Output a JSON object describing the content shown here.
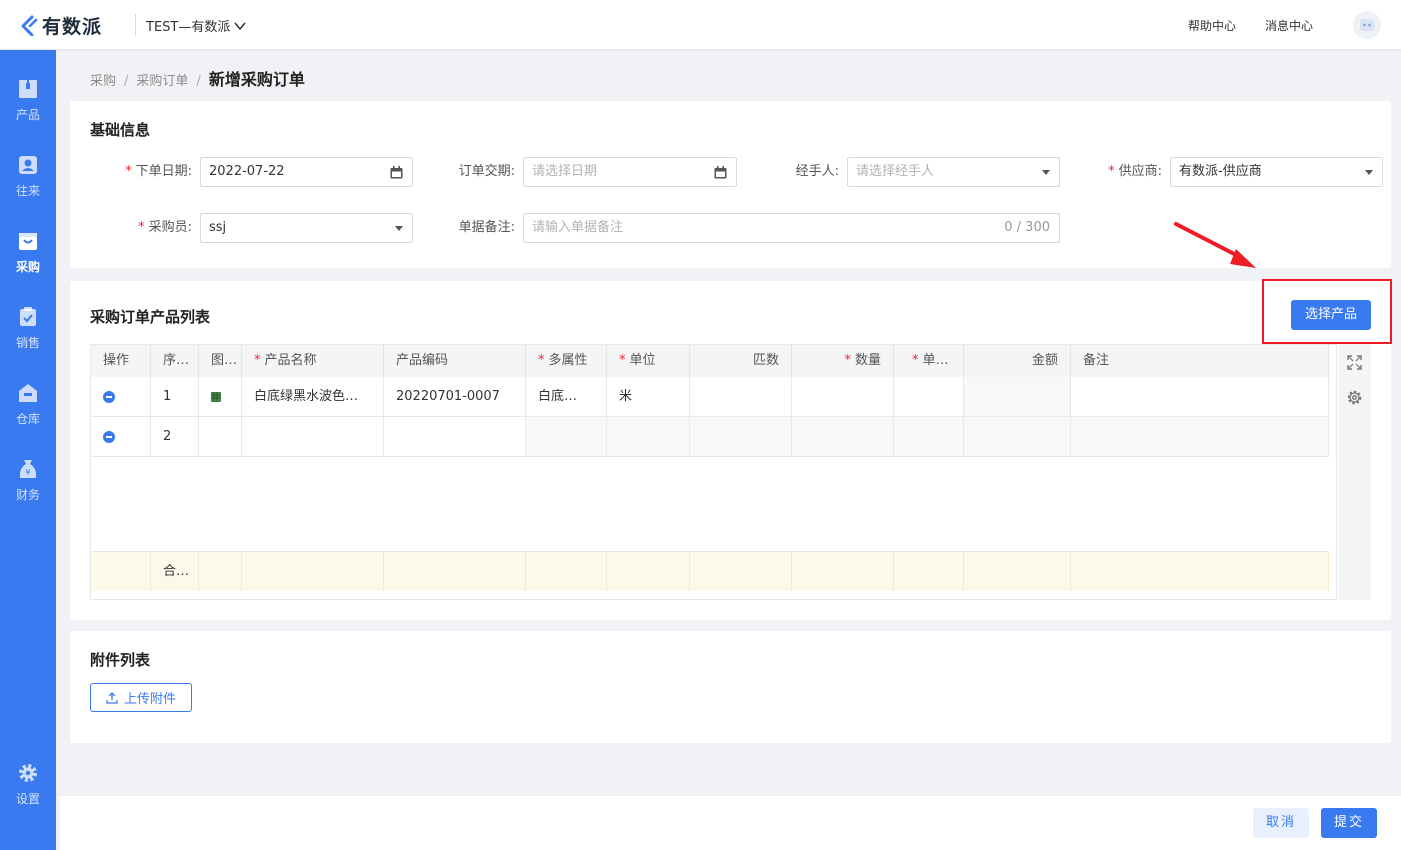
{
  "app": {
    "logo_text": "有数派",
    "company": "TEST—有数派",
    "help": "帮助中心",
    "messages": "消息中心"
  },
  "nav": [
    {
      "label": "产品",
      "icon": "box-icon"
    },
    {
      "label": "往来",
      "icon": "contacts-icon"
    },
    {
      "label": "采购",
      "icon": "bag-icon",
      "active": true
    },
    {
      "label": "销售",
      "icon": "clipboard-check-icon"
    },
    {
      "label": "仓库",
      "icon": "warehouse-icon"
    },
    {
      "label": "财务",
      "icon": "money-bag-icon"
    },
    {
      "label": "设置",
      "icon": "gear-icon"
    }
  ],
  "breadcrumb": [
    "采购",
    "采购订单",
    "新增采购订单"
  ],
  "basic": {
    "title": "基础信息",
    "order_date_label": "下单日期:",
    "order_date_value": "2022-07-22",
    "delivery_label": "订单交期:",
    "delivery_placeholder": "请选择日期",
    "handler_label": "经手人:",
    "handler_placeholder": "请选择经手人",
    "supplier_label": "供应商:",
    "supplier_value": "有数派-供应商",
    "buyer_label": "采购员:",
    "buyer_value": "ssj",
    "remark_label": "单据备注:",
    "remark_placeholder": "请输入单据备注",
    "remark_counter": "0 / 300"
  },
  "products": {
    "title": "采购订单产品列表",
    "select_button": "选择产品",
    "columns": [
      "操作",
      "序…",
      "图…",
      "产品名称",
      "产品编码",
      "多属性",
      "单位",
      "匹数",
      "数量",
      "单…",
      "金额",
      "备注"
    ],
    "rows": [
      {
        "index": "1",
        "name": "白底绿黑水波色…",
        "code": "20220701-0007",
        "attr": "白底…",
        "unit": "米"
      },
      {
        "index": "2",
        "name": "",
        "code": "",
        "attr": "",
        "unit": ""
      }
    ],
    "total_label": "合…"
  },
  "attachments": {
    "title": "附件列表",
    "upload_button": "上传附件"
  },
  "footer": {
    "cancel": "取消",
    "submit": "提交"
  }
}
